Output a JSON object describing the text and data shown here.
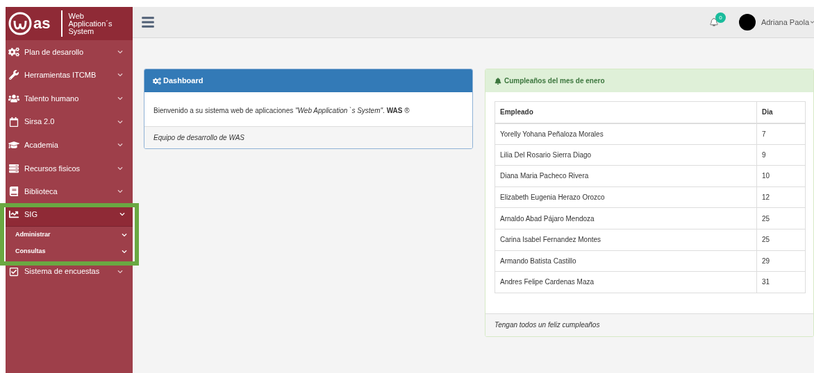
{
  "logo": {
    "mark": "as",
    "tagline": "Web Application´s System"
  },
  "sidebar": {
    "items": [
      {
        "label": "Plan de desarollo",
        "selected": false,
        "expanded": false
      },
      {
        "label": "Herramientas ITCMB",
        "selected": false,
        "expanded": false
      },
      {
        "label": "Talento humano",
        "selected": false,
        "expanded": false
      },
      {
        "label": "Sirsa 2.0",
        "selected": false,
        "expanded": false
      },
      {
        "label": "Academia",
        "selected": false,
        "expanded": false
      },
      {
        "label": "Recursos fisicos",
        "selected": false,
        "expanded": false
      },
      {
        "label": "Biblioteca",
        "selected": false,
        "expanded": false
      },
      {
        "label": "SIG",
        "selected": true,
        "expanded": true,
        "children": [
          {
            "label": "Administrar"
          },
          {
            "label": "Consultas"
          }
        ]
      },
      {
        "label": "Sistema de encuestas",
        "selected": false,
        "expanded": false
      }
    ]
  },
  "topbar": {
    "notifications": "0",
    "user": "Adriana Paola"
  },
  "dashboard": {
    "title": "Dashboard",
    "body": "Bienvenido a su sistema web de aplicaciones *\"Web Application `s System\"*. **WAS** ®",
    "footer": "Equipo de desarrollo de WAS"
  },
  "birthdays": {
    "title": "Cumpleaños del mes de enero",
    "columns": [
      "Empleado",
      "Dia"
    ],
    "rows": [
      [
        "Yorelly Yohana Peñaloza Morales",
        "7"
      ],
      [
        "Lilia Del Rosario Sierra Diago",
        "9"
      ],
      [
        "Diana Maria Pacheco Rivera",
        "10"
      ],
      [
        "Elizabeth Eugenia Herazo Orozco",
        "12"
      ],
      [
        "Arnaldo Abad Pájaro Mendoza",
        "25"
      ],
      [
        "Carina Isabel Fernandez Montes",
        "25"
      ],
      [
        "Armando Batista Castillo",
        "29"
      ],
      [
        "Andres Felipe Cardenas Maza",
        "31"
      ]
    ],
    "footer": "Tengan todos un feliz cumpleaños"
  }
}
